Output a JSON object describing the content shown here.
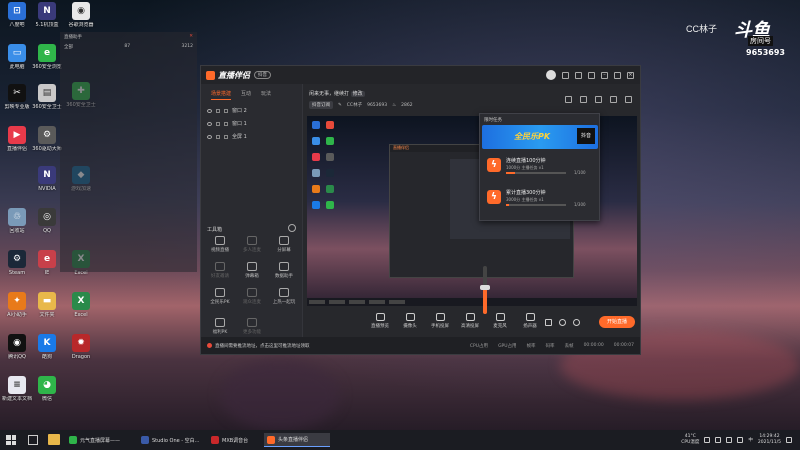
{
  "desktop": {
    "icons": [
      {
        "label": "八度吧",
        "color": "#2a6fd6",
        "glyph": "⊡"
      },
      {
        "label": "5.1机顶盒\nlite",
        "color": "#3a3a7a",
        "glyph": "N"
      },
      {
        "label": "谷歌浏览器",
        "color": "#e8e8e8",
        "glyph": "◉"
      },
      {
        "label": "此电脑",
        "color": "#3a8ee8",
        "glyph": "▭"
      },
      {
        "label": "360安全浏览",
        "color": "#2fb54a",
        "glyph": "e"
      },
      {
        "label": "360安全卫士",
        "color": "#2fb54a",
        "glyph": "✚"
      },
      {
        "label": "剪映专业版",
        "color": "#111111",
        "glyph": "✂"
      },
      {
        "label": "360安全卫士",
        "color": "#c8c8c8",
        "glyph": "▤"
      },
      {
        "label": "直播伴侣",
        "color": "#e83a4a",
        "glyph": "▶"
      },
      {
        "label": "360驱动大师",
        "color": "#5a5a5a",
        "glyph": "⚙"
      },
      {
        "label": "游戏加速",
        "color": "#1a6a9a",
        "glyph": "◆"
      },
      {
        "label": "NVIDIA",
        "color": "#3a3a7a",
        "glyph": "N"
      },
      {
        "label": "回收站",
        "color": "#7a9ab8",
        "glyph": "♲"
      },
      {
        "label": "QQ",
        "color": "#3a3a3a",
        "glyph": "◎"
      },
      {
        "label": "Steam",
        "color": "#1b2838",
        "glyph": "⚙"
      },
      {
        "label": "IE",
        "color": "#c8404a",
        "glyph": "e"
      },
      {
        "label": "Excel",
        "color": "#2a8a4a",
        "glyph": "X"
      },
      {
        "label": "Ai小助手",
        "color": "#e87a1a",
        "glyph": "✦"
      },
      {
        "label": "文件夹",
        "color": "#e8b84a",
        "glyph": "▬"
      },
      {
        "label": "Excel",
        "color": "#2a8a4a",
        "glyph": "X"
      },
      {
        "label": "腾讯QQ",
        "color": "#111111",
        "glyph": "◉"
      },
      {
        "label": "酷狗",
        "color": "#1a7ae8",
        "glyph": "K"
      },
      {
        "label": "Dragon",
        "color": "#b8282a",
        "glyph": "✹"
      },
      {
        "label": "新建文本文档",
        "color": "#e8e8f0",
        "glyph": "≡"
      },
      {
        "label": "微信",
        "color": "#2fb54a",
        "glyph": "◕"
      }
    ],
    "ghost_panel": {
      "header": "直播助手",
      "col1": "全部",
      "col2": "87",
      "col3": "3212"
    }
  },
  "streamer": {
    "name": "CC林子",
    "brand": "斗鱼",
    "brand_sub": "房间号",
    "room_id": "9653693"
  },
  "app": {
    "title": "直播伴侣",
    "version": "抖音",
    "left_tabs": [
      "场景搭建",
      "互动",
      "玩法"
    ],
    "scenes": [
      {
        "label": "窗口 2"
      },
      {
        "label": "窗口 1"
      },
      {
        "label": "全屏 1"
      }
    ],
    "tools_header": "工具箱",
    "tools": [
      {
        "label": "视频直播",
        "dim": false
      },
      {
        "label": "多人连麦",
        "dim": true
      },
      {
        "label": "分屏幕",
        "dim": false
      },
      {
        "label": "好友邀请",
        "dim": true
      },
      {
        "label": "弹幕箱",
        "dim": false
      },
      {
        "label": "数据助手",
        "dim": false
      },
      {
        "label": "全民乐PK",
        "dim": false
      },
      {
        "label": "观众连麦",
        "dim": true
      },
      {
        "label": "上热一起玩",
        "dim": false
      },
      {
        "label": "福利PK",
        "dim": false
      },
      {
        "label": "更多功能",
        "dim": true
      }
    ],
    "stream_title": "闲来无事，继续打",
    "edit_label": "修改",
    "tag": "抖音订阅",
    "user_info": "CC林子",
    "room": "9653693",
    "fans": "2862",
    "bottom_tools": [
      "直播预览",
      "摄像头",
      "手机投屏",
      "高清投屏",
      "麦克风",
      "扬声器"
    ],
    "go_live": "开始直播",
    "status_msg": "直播间需要推流地址，点击这里可推流地址领取",
    "stats": [
      "CPU占用",
      "GPU占用",
      "帧率",
      "码率",
      "丢帧"
    ],
    "time": "00:00:00",
    "time2": "00:00:07"
  },
  "popup": {
    "header": "限时任务",
    "banner_title": "全民乐PK",
    "banner_badge": "抖音",
    "tasks": [
      {
        "title": "连续直播100分钟",
        "sub": "1000分 主播任务 v1",
        "progress": 0.15,
        "count": "1/100"
      },
      {
        "title": "累计直播300分钟",
        "sub": "3000分 主播任务 v1",
        "progress": 0.05,
        "count": "1/300"
      }
    ]
  },
  "taskbar": {
    "tasks": [
      {
        "label": "元气直播屏幕——",
        "color": "#2fb54a",
        "active": false
      },
      {
        "label": "Studio One - 空白...",
        "color": "#3a5aa8",
        "active": false
      },
      {
        "label": "MXB调音台",
        "color": "#c8282a",
        "active": false
      },
      {
        "label": "头条直播伴侣",
        "color": "#ff6a2a",
        "active": true
      }
    ],
    "weather_temp": "41°C",
    "weather_desc": "CPU温度",
    "time": "14:29:42",
    "date": "2021/11/5",
    "lang": "中"
  }
}
